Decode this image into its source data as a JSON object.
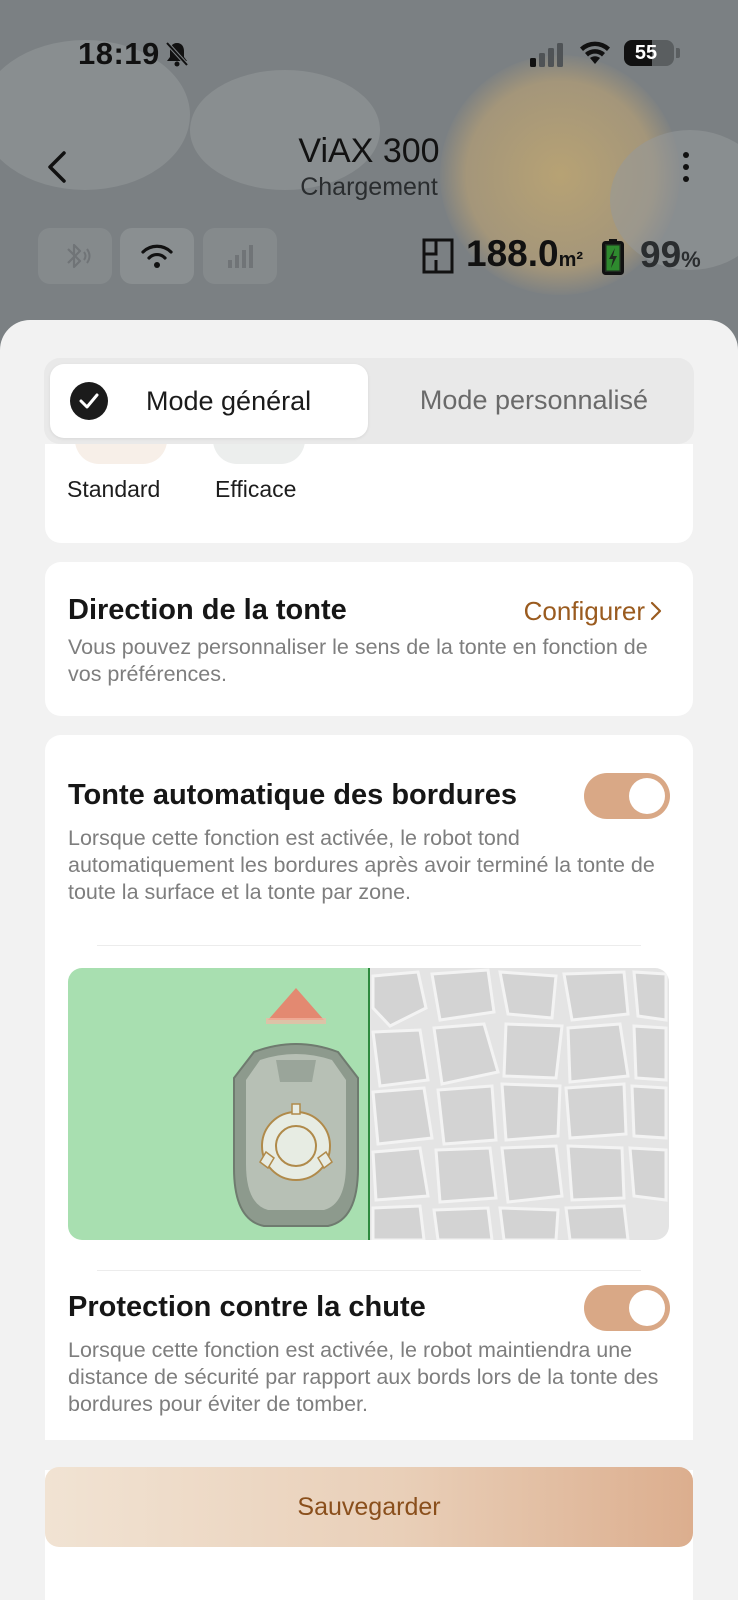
{
  "status_bar": {
    "time": "18:19",
    "battery_level": "55"
  },
  "header": {
    "device_name": "ViAX 300",
    "device_status": "Chargement"
  },
  "stats": {
    "area_value": "188.0",
    "area_unit": "m²",
    "battery_value": "99",
    "battery_unit": "%"
  },
  "mode_tabs": {
    "general": "Mode général",
    "custom": "Mode personnalisé",
    "selected": "general"
  },
  "mowing_options": [
    {
      "label": "Standard"
    },
    {
      "label": "Efficace"
    }
  ],
  "direction": {
    "title": "Direction de la tonte",
    "action": "Configurer",
    "description": "Vous pouvez personnaliser le sens de la tonte en fonction de vos préférences."
  },
  "edge_mowing": {
    "title": "Tonte automatique des bordures",
    "enabled": true,
    "description": "Lorsque cette fonction est activée, le robot tond automatiquement les bordures après avoir terminé la tonte de toute la surface et la tonte par zone."
  },
  "fall_protection": {
    "title": "Protection contre la chute",
    "enabled": true,
    "description": "Lorsque cette fonction est activée, le robot maintiendra une distance de sécurité par rapport aux bords lors de la tonte des bordures pour éviter de tomber."
  },
  "save_button": "Sauvegarder",
  "colors": {
    "accent": "#9a5b1f",
    "toggle_on": "#d9a886",
    "grass": "#a8dfb0"
  },
  "icons": [
    "back-icon",
    "more-icon",
    "bluetooth-icon",
    "wifi-icon",
    "cellular-icon",
    "area-icon",
    "battery-icon",
    "check-icon",
    "chevron-right-icon"
  ]
}
